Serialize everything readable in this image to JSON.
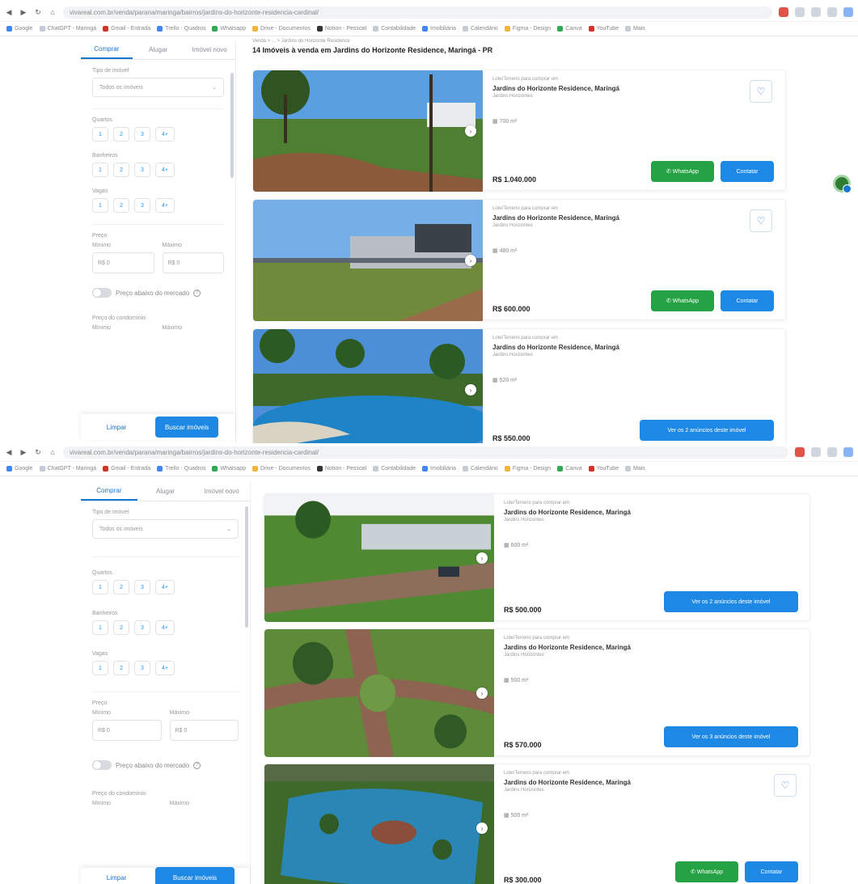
{
  "browser": {
    "url": "vivareal.com.br/venda/parana/maringa/bairros/jardins-do-horizonte-residencia-cardinal/",
    "bookmarks": [
      "Google",
      "ChatGPT - Maringá",
      "Gmail - Entrada",
      "Trello - Quadros",
      "Whatsapp",
      "Drive - Documentos",
      "Notion - Pessoal",
      "Contabilidade",
      "Imobiliária",
      "Calendário",
      "Figma - Design",
      "Canva",
      "YouTube",
      "Mais"
    ]
  },
  "search": {
    "tabs": [
      "Comprar",
      "Alugar",
      "Imóvel novo"
    ],
    "tipo_label": "Tipo de imóvel",
    "tipo_value": "Todos os imóveis",
    "quartos_label": "Quartos",
    "banheiros_label": "Banheiros",
    "vagas_label": "Vagas",
    "count_options": [
      "1",
      "2",
      "3",
      "4+"
    ],
    "preco_label": "Preço",
    "min_label": "Mínimo",
    "max_label": "Máximo",
    "min_placeholder": "R$ 0",
    "max_placeholder": "R$ 0",
    "toggle_label": "Preço abaixo do mercado",
    "cond_label": "Preço do condomínio",
    "limpar": "Limpar",
    "buscar": "Buscar imóveis"
  },
  "results": {
    "breadcrumb": "Venda > ... > Jardins do Horizonte Residence",
    "title": "14 Imóveis à venda em Jardins do Horizonte Residence, Maringá - PR"
  },
  "card_common": {
    "type": "Lote/Terreno para comprar em",
    "address": "Jardins do Horizonte Residence, Maringá",
    "neighborhood": "Jardins Horizontes",
    "whatsapp": "WhatsApp",
    "contatar": "Contatar",
    "favorite_icon": "heart-icon"
  },
  "cards_top": [
    {
      "area": "700 m²",
      "price": "R$ 1.040.000",
      "ads": null,
      "scene": "lawn-trees"
    },
    {
      "area": "480 m²",
      "price": "R$ 600.000",
      "ads": null,
      "scene": "building-field"
    },
    {
      "area": "520 m²",
      "price": "R$ 550.000",
      "ads": "Ver os 2 anúncios deste imóvel",
      "scene": "pool-palms"
    }
  ],
  "cards_bottom": [
    {
      "area": "600 m²",
      "price": "R$ 500.000",
      "ads": "Ver os 2 anúncios deste imóvel",
      "scene": "road-car"
    },
    {
      "area": "500 m²",
      "price": "R$ 570.000",
      "ads": "Ver os 3 anúncios deste imóvel",
      "scene": "roundabout"
    },
    {
      "area": "500 m²",
      "price": "R$ 300.000",
      "ads": null,
      "scene": "aerial-pool"
    }
  ]
}
